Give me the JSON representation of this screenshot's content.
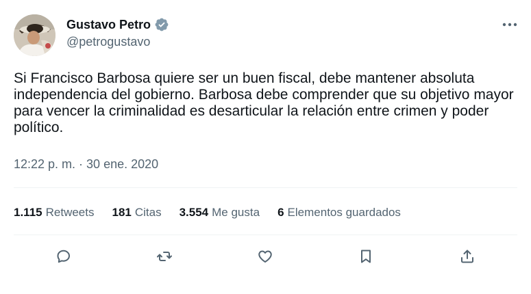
{
  "author": {
    "name": "Gustavo Petro",
    "handle": "@petrogustavo",
    "verified": true,
    "verified_color": "#829aab"
  },
  "tweet": {
    "text": "Si Francisco Barbosa quiere ser un buen fiscal, debe mantener absoluta independencia del gobierno. Barbosa debe comprender que su objetivo mayor para vencer la criminalidad es desarticular la relación entre crimen y poder político.",
    "timestamp": "12:22 p. m. · 30 ene. 2020"
  },
  "stats": [
    {
      "count": "1.115",
      "label": "Retweets"
    },
    {
      "count": "181",
      "label": "Citas"
    },
    {
      "count": "3.554",
      "label": "Me gusta"
    },
    {
      "count": "6",
      "label": "Elementos guardados"
    }
  ],
  "actions": [
    "reply-icon",
    "retweet-icon",
    "like-icon",
    "bookmark-icon",
    "share-icon"
  ],
  "menu_icon": "more-icon",
  "colors": {
    "text_primary": "#0f1419",
    "text_secondary": "#536471",
    "divider": "#eff3f4"
  }
}
